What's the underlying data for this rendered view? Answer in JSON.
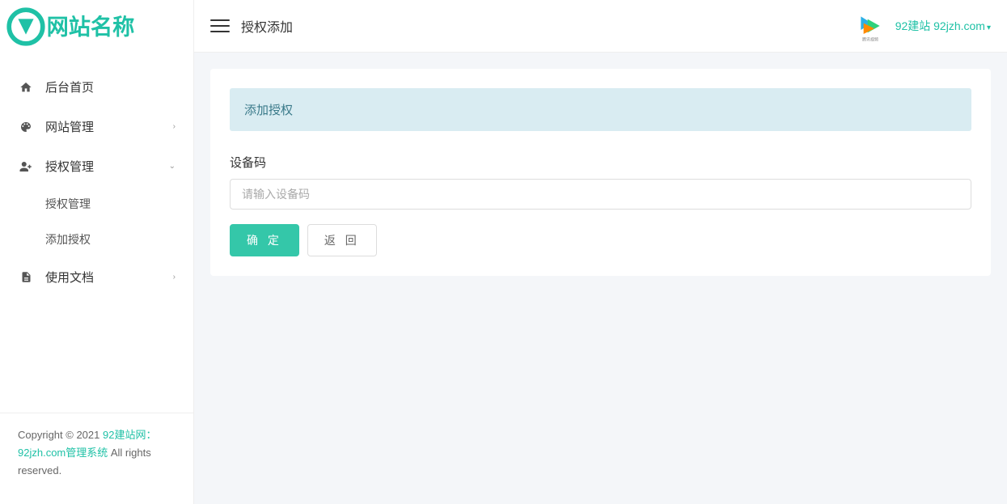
{
  "logo_text": "网站名称",
  "sidebar": {
    "items": [
      {
        "label": "后台首页",
        "icon": "home",
        "expandable": false
      },
      {
        "label": "网站管理",
        "icon": "palette",
        "expandable": true,
        "expanded": false
      },
      {
        "label": "授权管理",
        "icon": "person-plus",
        "expandable": true,
        "expanded": true,
        "children": [
          {
            "label": "授权管理"
          },
          {
            "label": "添加授权"
          }
        ]
      },
      {
        "label": "使用文档",
        "icon": "doc",
        "expandable": true,
        "expanded": false
      }
    ]
  },
  "footer": {
    "prefix": "Copyright © 2021 ",
    "link": "92建站网：92jzh.com管理系统",
    "suffix": " All rights reserved."
  },
  "header": {
    "page_title": "授权添加",
    "user_text": "92建站 92jzh.com"
  },
  "card": {
    "title": "添加授权",
    "device_label": "设备码",
    "device_placeholder": "请输入设备码",
    "confirm_label": "确 定",
    "back_label": "返 回"
  }
}
